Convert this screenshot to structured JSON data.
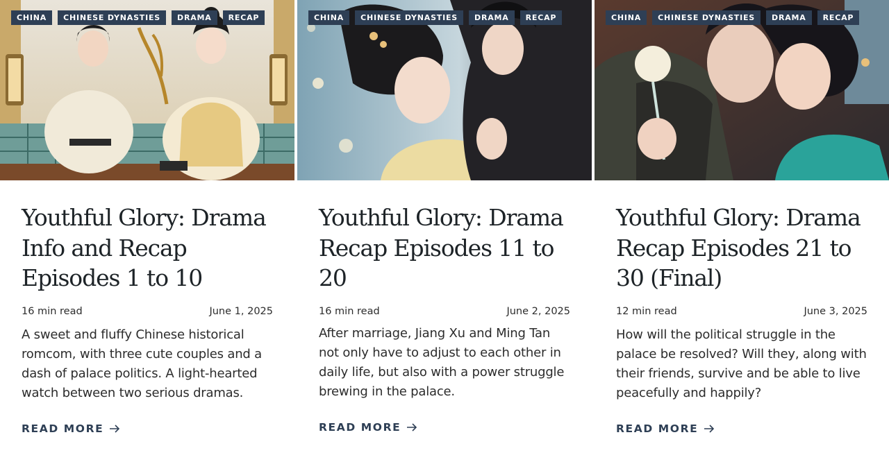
{
  "colors": {
    "tag_bg": "#2e3f55",
    "link": "#2e3f55",
    "text": "#1d2327"
  },
  "cards": [
    {
      "tags": [
        "CHINA",
        "CHINESE DYNASTIES",
        "DRAMA",
        "RECAP"
      ],
      "title": "Youthful Glory: Drama Info and Recap Episodes 1 to 10",
      "read_time": "16 min read",
      "date": "June 1, 2025",
      "excerpt": "A sweet and fluffy Chinese historical romcom, with three cute couples and a dash of palace politics. A light-hearted watch between two serious dramas.",
      "read_more": "READ MORE",
      "image_alt": "poster-two-leads-seated"
    },
    {
      "tags": [
        "CHINA",
        "CHINESE DYNASTIES",
        "DRAMA",
        "RECAP"
      ],
      "title": "Youthful Glory: Drama Recap Episodes 11 to 20",
      "read_time": "16 min read",
      "date": "June 2, 2025",
      "excerpt": "After marriage, Jiang Xu and Ming Tan not only have to adjust to each other in daily life, but also with a power struggle brewing in the palace.",
      "read_more": "READ MORE",
      "image_alt": "still-couple-close"
    },
    {
      "tags": [
        "CHINA",
        "CHINESE DYNASTIES",
        "DRAMA",
        "RECAP"
      ],
      "title": "Youthful Glory: Drama Recap Episodes 21 to 30 (Final)",
      "read_time": "12 min read",
      "date": "June 3, 2025",
      "excerpt": "How will the political struggle in the palace be resolved? Will they, along with their friends, survive and be able to live peacefully and happily?",
      "read_more": "READ MORE",
      "image_alt": "still-couple-kiss"
    }
  ]
}
